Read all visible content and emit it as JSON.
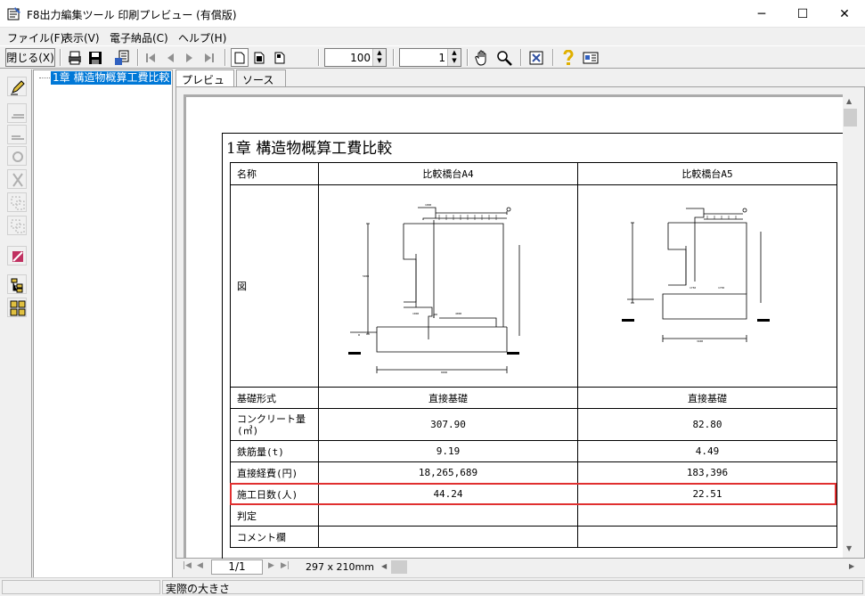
{
  "window": {
    "title": "F8出力編集ツール 印刷プレビュー (有償版)",
    "minimize": "─",
    "maximize": "☐",
    "close": "✕"
  },
  "menu": {
    "file": "ファイル(F)",
    "view": "表示(V)",
    "edelivery": "電子納品(C)",
    "help": "ヘルプ(H)"
  },
  "toolbar": {
    "close_label": "閉じる(X)",
    "zoom_value": "100",
    "page_value": "1"
  },
  "tree": {
    "item": "1章 構造物概算工費比較"
  },
  "tabs": {
    "preview": "プレビュー",
    "source": "ソース"
  },
  "document": {
    "title": "1章 構造物概算工費比較",
    "headers": {
      "name": "名称",
      "a4": "比較橋台A4",
      "a5": "比較橋台A5"
    },
    "figure_label": "図",
    "rows": [
      {
        "label": "基礎形式",
        "a4": "直接基礎",
        "a5": "直接基礎"
      },
      {
        "label": "コンクリート量(㎥)",
        "a4": "307.90",
        "a5": "82.80"
      },
      {
        "label": "鉄筋量(t)",
        "a4": "9.19",
        "a5": "4.49"
      },
      {
        "label": "直接経費(円)",
        "a4": "18,265,689",
        "a5": "183,396"
      },
      {
        "label": "施工日数(人)",
        "a4": "44.24",
        "a5": "22.51"
      },
      {
        "label": "判定",
        "a4": "",
        "a5": ""
      },
      {
        "label": "コメント欄",
        "a4": "",
        "a5": ""
      }
    ]
  },
  "pager": {
    "page": "1/1",
    "size": "297 x 210mm"
  },
  "status": {
    "text": "実際の大きさ"
  },
  "colors": {
    "highlight": "#e03030",
    "selection": "#0078d7"
  }
}
